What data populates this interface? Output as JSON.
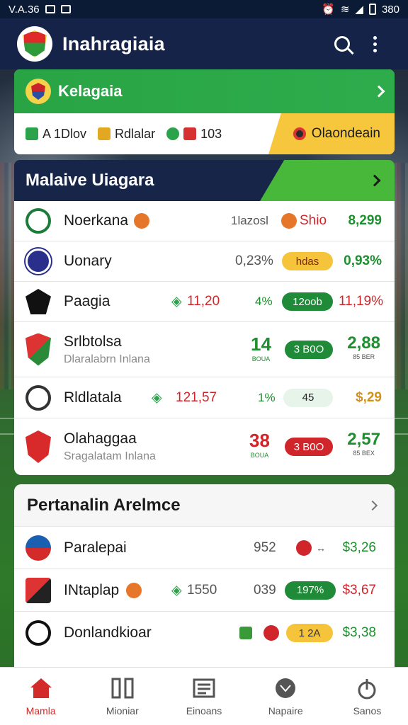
{
  "status_bar": {
    "time": "V.A.36",
    "battery": "380"
  },
  "app": {
    "title": "Inahragiaia"
  },
  "featured": {
    "title": "Kelagaia",
    "items": [
      {
        "label": "A 1Dlov",
        "color": "#2aa34a"
      },
      {
        "label": "Rdlalar",
        "color": "#e3a822"
      },
      {
        "label": "103",
        "color": "#d63030"
      }
    ],
    "highlight": "Olaondeain"
  },
  "section1": {
    "title": "Malaive Uiagara",
    "rows": [
      {
        "name": "Noerkana",
        "col1": "1lazosl",
        "col2": "Shio",
        "value": "8,299"
      },
      {
        "name": "Uonary",
        "col1": "0,23%",
        "pill": "hdas",
        "value": "0,93%"
      },
      {
        "name": "Paagia",
        "col1": "11,20",
        "col2": "4%",
        "pill": "12oob",
        "value": "11,19%"
      },
      {
        "name": "Srlbtolsa",
        "sub": "Dlaralabrn Inlana",
        "score": "14",
        "score_sub": "BOUA",
        "pill": "3 B0O",
        "value": "2,88",
        "value_sub": "85 BER"
      },
      {
        "name": "Rldlatala",
        "col1": "121,57",
        "col2": "1%",
        "pill": "45",
        "value": "$,29"
      },
      {
        "name": "Olahaggaa",
        "sub": "Sragalatam Inlana",
        "score": "38",
        "score_sub": "BOUA",
        "pill": "3 B0O",
        "value": "2,57",
        "value_sub": "85 BEX"
      }
    ]
  },
  "section2": {
    "title": "Pertanalin Arelmce",
    "rows": [
      {
        "name": "Paralepai",
        "col1": "952",
        "col2": "↔",
        "value": "$3,26"
      },
      {
        "name": "INtaplap",
        "col1": "1550",
        "col2": "039",
        "pill": "197%",
        "value": "$3,67"
      },
      {
        "name": "Donlandkioar",
        "pill": "1 2A",
        "value": "$3,38"
      }
    ]
  },
  "nav": [
    {
      "label": "Mamla",
      "icon": "home-icon",
      "active": true
    },
    {
      "label": "Mioniar",
      "icon": "columns-icon"
    },
    {
      "label": "Einoans",
      "icon": "news-icon"
    },
    {
      "label": "Napaire",
      "icon": "ball-icon"
    },
    {
      "label": "Sanos",
      "icon": "hand-icon"
    }
  ],
  "colors": {
    "navy": "#142347",
    "green": "#29a445",
    "red": "#d0262b",
    "gold": "#f6c63c"
  }
}
